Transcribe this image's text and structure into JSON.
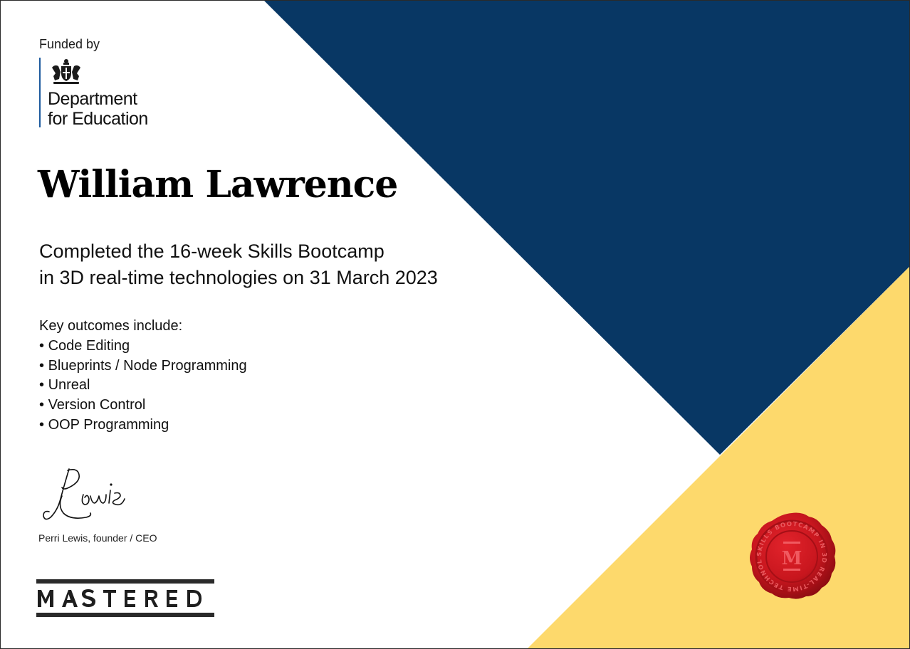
{
  "colors": {
    "navy": "#083764",
    "yellow": "#fdd96c",
    "seal_red": "#c8161e",
    "dfe_blue": "#1d5a9e"
  },
  "funder": {
    "funded_by_label": "Funded by",
    "department_line1": "Department",
    "department_line2": "for Education",
    "crest_icon": "royal-coat-of-arms-icon"
  },
  "recipient": {
    "name": "William Lawrence"
  },
  "completion": {
    "line1": "Completed the 16-week Skills Bootcamp",
    "line2": "in 3D real-time technologies on 31 March 2023"
  },
  "outcomes": {
    "heading": "Key outcomes include:",
    "items": [
      "Code Editing",
      "Blueprints / Node Programming",
      "Unreal",
      "Version Control",
      "OOP Programming"
    ]
  },
  "signatory": {
    "signature_text": "PLewis",
    "caption": "Perri Lewis, founder / CEO"
  },
  "brand": {
    "logo_text": "MASTERED"
  },
  "seal": {
    "monogram": "M",
    "ring_text": "SKILLS BOOTCAMP IN 3D REAL-TIME TECHNOLOGIES"
  }
}
